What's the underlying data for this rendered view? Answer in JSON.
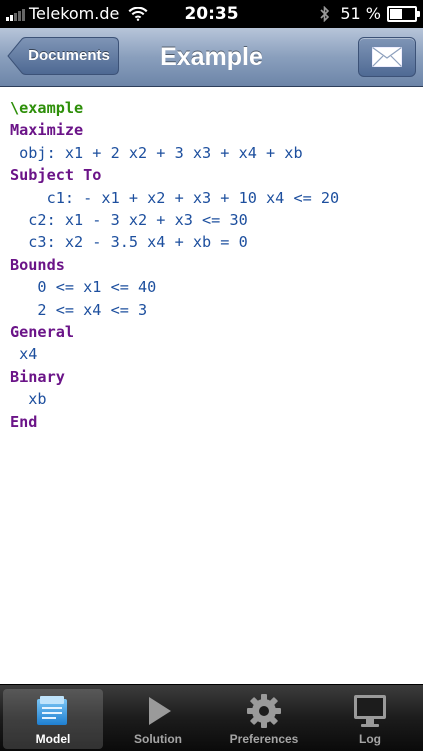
{
  "status": {
    "carrier": "Telekom.de",
    "time": "20:35",
    "battery": "51 %"
  },
  "nav": {
    "back_label": "Documents",
    "title": "Example",
    "mail_icon": "mail-icon"
  },
  "code": [
    [
      {
        "t": "\\example",
        "s": "cm"
      }
    ],
    [
      {
        "t": "Maximize",
        "s": "kw"
      }
    ],
    [
      {
        "t": " obj: x1 + 2 x2 + 3 x3 + x4 + xb",
        "s": "ex"
      }
    ],
    [
      {
        "t": "Subject To",
        "s": "kw"
      }
    ],
    [
      {
        "t": "    c1: - x1 + x2 + x3 + 10 x4 <= 20",
        "s": "ex"
      }
    ],
    [
      {
        "t": "  c2: x1 - 3 x2 + x3 <= 30",
        "s": "ex"
      }
    ],
    [
      {
        "t": "  c3: x2 - 3.5 x4 + xb = 0",
        "s": "ex"
      }
    ],
    [
      {
        "t": "Bounds",
        "s": "kw"
      }
    ],
    [
      {
        "t": "   0 <= x1 <= 40",
        "s": "ex"
      }
    ],
    [
      {
        "t": "   2 <= x4 <= 3",
        "s": "ex"
      }
    ],
    [
      {
        "t": "General",
        "s": "kw"
      }
    ],
    [
      {
        "t": " x4",
        "s": "ex"
      }
    ],
    [
      {
        "t": "Binary",
        "s": "kw"
      }
    ],
    [
      {
        "t": "  xb",
        "s": "ex"
      }
    ],
    [
      {
        "t": "End",
        "s": "kw"
      }
    ]
  ],
  "tabs": [
    {
      "label": "Model",
      "icon": "model-icon",
      "active": true
    },
    {
      "label": "Solution",
      "icon": "play-icon",
      "active": false
    },
    {
      "label": "Preferences",
      "icon": "gear-icon",
      "active": false
    },
    {
      "label": "Log",
      "icon": "monitor-icon",
      "active": false
    }
  ],
  "colors": {
    "keyword": "#6b1488",
    "comment": "#2e8f0a",
    "expression": "#1d4f9e"
  }
}
